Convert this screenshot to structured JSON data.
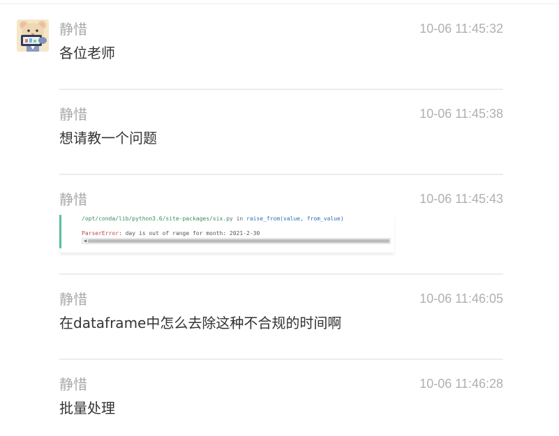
{
  "messages": [
    {
      "sender": "静惜",
      "time": "10-06 11:45:32",
      "text": "各位老师"
    },
    {
      "sender": "静惜",
      "time": "10-06 11:45:38",
      "text": "想请教一个问题"
    },
    {
      "sender": "静惜",
      "time": "10-06 11:45:43",
      "image": {
        "line1_path": "/opt/conda/lib/python3.6/site-packages/six.py",
        "line1_in": " in ",
        "line1_func": "raise_from(value, from_value)",
        "line2_error": "ParserError",
        "line2_rest": ": day is out of range for month: 2021-2-30"
      }
    },
    {
      "sender": "静惜",
      "time": "10-06 11:46:05",
      "text": "在dataframe中怎么去除这种不合规的时间啊"
    },
    {
      "sender": "静惜",
      "time": "10-06 11:46:28",
      "text": "批量处理"
    }
  ],
  "icons": {
    "avatar": "cartoon-hamster-avatar-icon",
    "scroll_left": "scroll-left-arrow-icon"
  },
  "colors": {
    "sender": "#a9a9a9",
    "time": "#b0b0b0",
    "text": "#333333",
    "divider": "#ececec",
    "code_accent": "#5bbf9e"
  }
}
